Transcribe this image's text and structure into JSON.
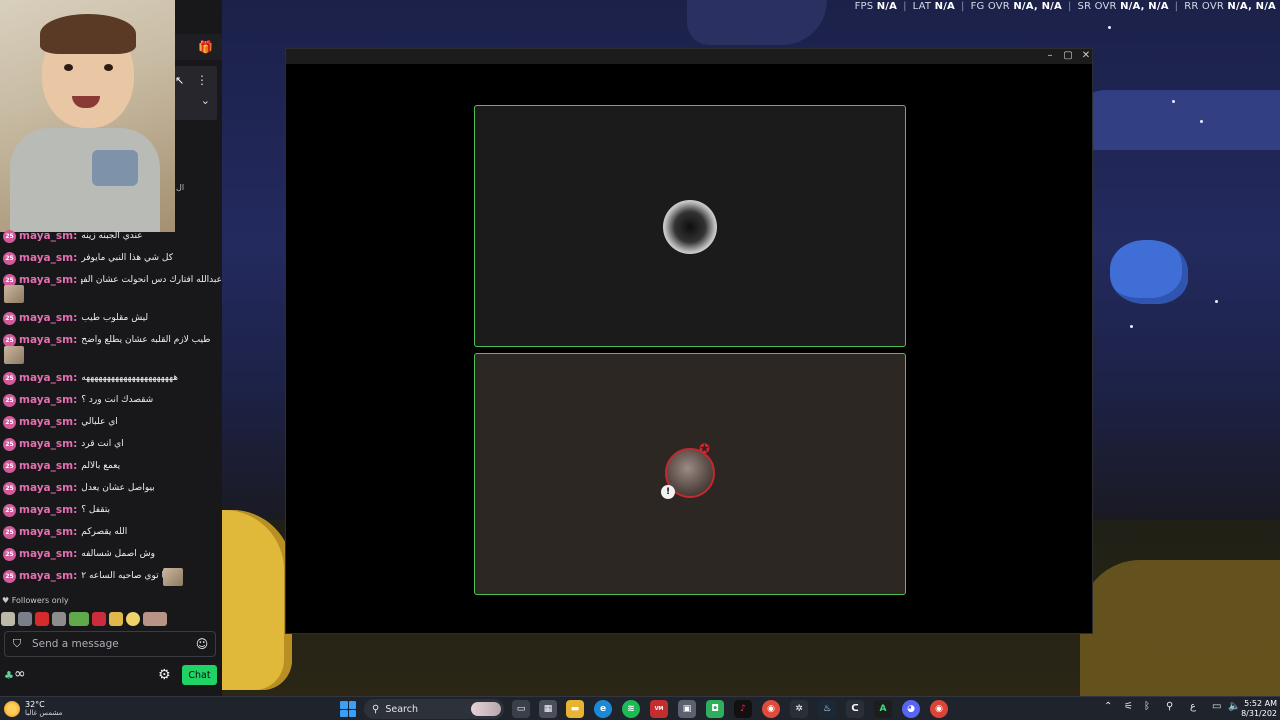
{
  "perf": [
    {
      "label": "FPS",
      "value": "N/A"
    },
    {
      "label": "LAT",
      "value": "N/A"
    },
    {
      "label": "FG OVR",
      "value": "N/A, N/A"
    },
    {
      "label": "SR OVR",
      "value": "N/A, N/A"
    },
    {
      "label": "RR OVR",
      "value": "N/A, N/A"
    }
  ],
  "chat": {
    "messages": [
      {
        "user": "maya_sm:",
        "text": "عندي الجبنه زينه"
      },
      {
        "user": "maya_sm:",
        "text": "كل شي هذا النبي مايوفر"
      },
      {
        "user": "maya_sm:",
        "text": "عبدالله افتارك دس انحولت عشان الفهمه"
      },
      {
        "user": "maya_sm:",
        "text": "ليش مقلوب طيب"
      },
      {
        "user": "maya_sm:",
        "text": "طيب لازم القلبه عشان يطلع واضح"
      },
      {
        "user": "maya_sm:",
        "text": "ههههههههههههههههههههههه"
      },
      {
        "user": "maya_sm:",
        "text": "شقصدك انت ورد ؟"
      },
      {
        "user": "maya_sm:",
        "text": "اي علبالي"
      },
      {
        "user": "maya_sm:",
        "text": "اي انت قرد"
      },
      {
        "user": "maya_sm:",
        "text": "يعمع بالالم"
      },
      {
        "user": "maya_sm:",
        "text": "بيواصل عشان يعدل"
      },
      {
        "user": "maya_sm:",
        "text": "بتقفل ؟"
      },
      {
        "user": "maya_sm:",
        "text": "الله يقصركم"
      },
      {
        "user": "maya_sm:",
        "text": "وش اصمل شسالفه"
      },
      {
        "user": "maya_sm:",
        "text": "انا توي صاحيه الساعه ٢"
      }
    ],
    "badge_text": "25",
    "followers_only": "Followers only",
    "input_placeholder": "Send a message",
    "points_value": "∞",
    "chat_button": "Chat",
    "side_glyph": "ال"
  },
  "window": {
    "minimize": "–",
    "maximize": "▢",
    "close": "✕",
    "mute_badge": "!"
  },
  "taskbar": {
    "temperature": "32°C",
    "condition": "مشمس غالبا",
    "search_label": "Search",
    "time": "5:52 AM",
    "date": "8/31/202",
    "lang": "ع"
  },
  "colors": {
    "chat_bg": "#18181b",
    "username": "#e36fb0",
    "chat_button": "#1fd364",
    "tile_border": "#4fbf5a"
  }
}
